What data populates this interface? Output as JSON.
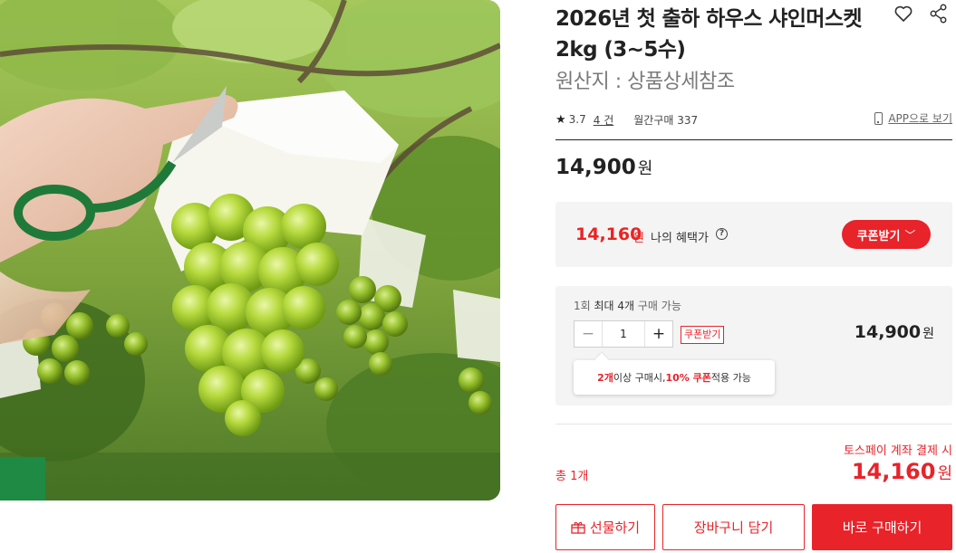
{
  "product": {
    "title": "2026년 첫 출하 하우스 샤인머스켓 2kg (3~5수)",
    "origin": "원산지 : 상품상세참조",
    "image_alt": "Shine Muscat grape cluster being harvested"
  },
  "rating": {
    "star_icon": "★",
    "value": "3.7",
    "review_count": "4 건",
    "monthly_purchases": "월간구매 337",
    "app_link": "APP으로 보기"
  },
  "price": {
    "amount": "14,900",
    "unit": "원"
  },
  "benefit": {
    "price": "14,160",
    "unit": "원",
    "label": "나의 혜택가",
    "info_icon": "?",
    "coupon_button": "쿠폰받기",
    "chevron": "﹀"
  },
  "option": {
    "limit_prefix": "1회 ",
    "limit_mid": "최대 4개",
    "limit_suffix": " 구매 가능",
    "minus": "−",
    "quantity": "1",
    "plus": "+",
    "coupon_tag": "쿠폰받기",
    "price": "14,900",
    "unit": "원",
    "tooltip_red1": "2개",
    "tooltip_text1": " 이상 구매시, ",
    "tooltip_red2": "10% 쿠폰",
    "tooltip_text2": " 적용 가능"
  },
  "summary": {
    "toss_text": "토스페이 계좌 결제 시",
    "total_count": "총 1개",
    "total_price": "14,160",
    "unit": "원"
  },
  "actions": {
    "gift": "선물하기",
    "cart": "장바구니 담기",
    "buy": "바로 구매하기"
  },
  "colors": {
    "accent": "#e8232a",
    "panel_bg": "#f4f4f4",
    "text": "#222222"
  }
}
